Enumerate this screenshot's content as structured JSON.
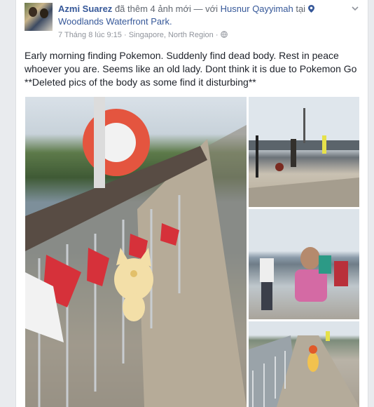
{
  "post": {
    "author": "Azmi Suarez",
    "action": "đã thêm 4 ảnh mới — với",
    "tagged": "Husnur Qayyimah",
    "place_prefix": "tại",
    "place": "Woodlands Waterfront Park.",
    "date": "7 Tháng 8 lúc 9:15",
    "separator": "·",
    "location": "Singapore, North Region",
    "text": "Early morning finding Pokemon. Suddenly find dead body. Rest in peace whoever you are. Seems like an old lady. Dont think it is due to Pokemon Go **Deleted pics of the body as some find it disturbing**"
  },
  "icons": [
    "place-pin-icon",
    "chevron-down-icon",
    "globe-icon"
  ],
  "colors": {
    "link": "#365899",
    "meta": "#90949c",
    "text": "#1d2129",
    "background": "#e9ebee"
  }
}
